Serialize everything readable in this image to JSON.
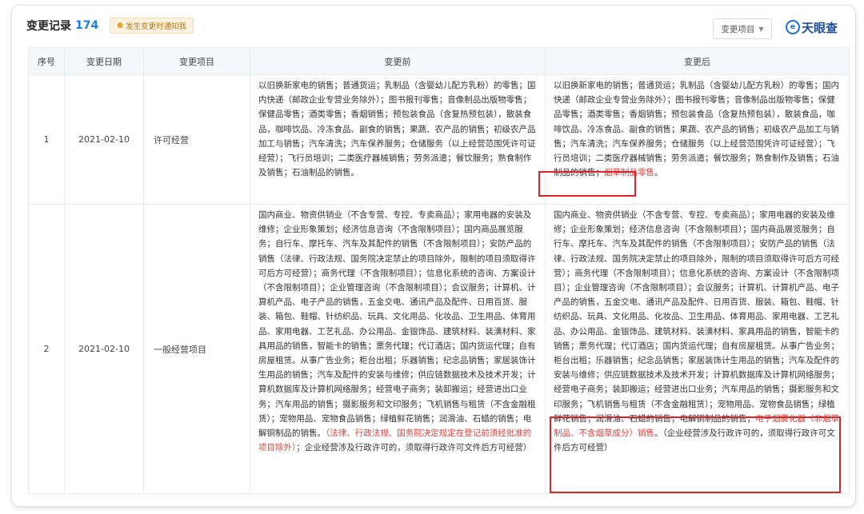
{
  "header": {
    "title": "变更记录",
    "count": "174",
    "notify_label": "发生变更时通知我",
    "filter_label": "变更项目",
    "brand": "天眼查"
  },
  "table": {
    "columns": [
      "序号",
      "变更日期",
      "变更项目",
      "变更前",
      "变更后"
    ],
    "rows": [
      {
        "index": "1",
        "date": "2021-02-10",
        "item": "许可经营",
        "before": "以旧换新家电的销售；普通货运；乳制品（含婴幼儿配方乳粉）的零售；国内快递（邮政企业专营业务除外）；图书报刊零售；音像制品出版物零售；保健品零售；酒类零售；香烟销售；预包装食品（含复热预包装），散装食品，咖啡饮品、冷冻食品、副食的销售；果蔬、农产品的销售；初级农产品加工与销售；汽车清洗；汽车保养服务；仓储服务（以上经营范围凭许可证经营）；飞行员培训；二类医疗器械销售；劳务派遣；餐饮服务；熟食制作及销售；石油制品的销售。",
        "after": "以旧换新家电的销售；普通货运；乳制品（含婴幼儿配方乳粉）的零售；国内快递（邮政企业专营业务除外）；图书报刊零售；音像制品出版物零售；保健品零售；酒类零售；香烟销售；预包装食品（含复热预包装），散装食品，咖啡饮品、冷冻食品、副食的销售；果蔬、农产品的销售；初级农产品加工与销售；汽车清洗；汽车保养服务；仓储服务（以上经营范围凭许可证经营）；飞行员培训；二类医疗器械销售；劳务派遣；餐饮服务；熟食制作及销售；石油制品的销售；",
        "after_highlight": "烟草制品零售",
        "after_tail": "。"
      },
      {
        "index": "2",
        "date": "2021-02-10",
        "item": "一般经营项目",
        "before": "国内商业、物资供销业（不含专营、专控、专卖商品）；家用电器的安装及维修；企业形象策划；经济信息咨询（不含限制项目）；国内商品展览服务；自行车、摩托车、汽车及其配件的销售（不含限制项目）；安防产品的销售（法律、行政法规、国务院决定禁止的项目除外，限制的项目须取得许可后方可经营）；商务代理（不含限制项目）；信息化系统的咨询、方案设计（不含限制项目）；企业管理咨询（不含限制项目）；会议服务；计算机、计算机产品、电子产品的销售，五金交电、通讯产品及配件、日用百货、服装、箱包、鞋帽、针纺织品、玩具、文化用品、化妆品、卫生用品、体育用品、家用电器、工艺礼品、办公用品、金银饰品、建筑材料、装潢材料、家具用品的销售，智能卡的销售；票务代理；代订酒店；国内货运代理；自有房屋租赁。从事广告业务；柜台出租；乐器销售；纪念品销售；家居装饰计生用品的销售；汽车及配件的安装与维修；供应链数据技术及技术开发；计算机数据库及计算机网络服务；经营电子商务；装卸搬运；经营进出口业务；汽车用品的销售；摄影服务和文印服务；飞机销售与租赁（不含金融租赁）；宠物用品、宠物食品销售；绿植鲜花销售；润滑油、石蜡的销售；电解铜制品的销售。",
        "before_red": "（法律、行政法规、国务院决定规定在登记前须经批准的项目除外）",
        "before_tail": "；企业经营涉及行政许可的，须取得行政许可文件后方可经营）",
        "after": "国内商业、物资供销业（不含专营、专控、专卖商品）；家用电器的安装及维修；企业形象策划；经济信息咨询（不含限制项目）；国内商品展览服务；自行车、摩托车、汽车及其配件的销售（不含限制项目）；安防产品的销售（法律、行政法规、国务院决定禁止的项目除外，限制的项目须取得许可后方可经营）；商务代理（不含限制项目）；信息化系统的咨询、方案设计（不含限制项目）；企业管理咨询（不含限制项目）；会议服务；计算机、计算机产品、电子产品的销售，五金交电、通讯产品及配件、日用百货、服装、箱包、鞋帽、针纺织品、玩具、文化用品、化妆品、卫生用品、体育用品、家用电器、工艺礼品、办公用品、金银饰品、建筑材料、装潢材料、家具用品的销售，智能卡的销售；票务代理；代订酒店；国内货运代理；自有房屋租赁。从事广告业务；柜台出租；乐器销售；纪念品销售；家居装饰计生用品的销售；汽车及配件的安装与维修；供应链数据技术及技术开发；计算机数据库及计算机网络服务；经营电子商务；装卸搬运；经营进出口业务；汽车用品的销售；摄影服务和文印服务；飞机销售与租赁（不含金融租赁）；宠物用品、宠物食品销售；绿植鲜花销售；润滑油、石蜡的销售；电解铜制品的销售；",
        "after_highlight": "电子烟雾化器（非烟草制品、不含烟草成分）销售",
        "after_tail": "。（企业经营涉及行政许可的，须取得行政许可文件后方可经营）"
      }
    ]
  },
  "colors": {
    "accent": "#1a7de0",
    "highlight_text": "#e0413b",
    "highlight_box": "#d9262b",
    "header_bg": "#f3f8fd"
  }
}
